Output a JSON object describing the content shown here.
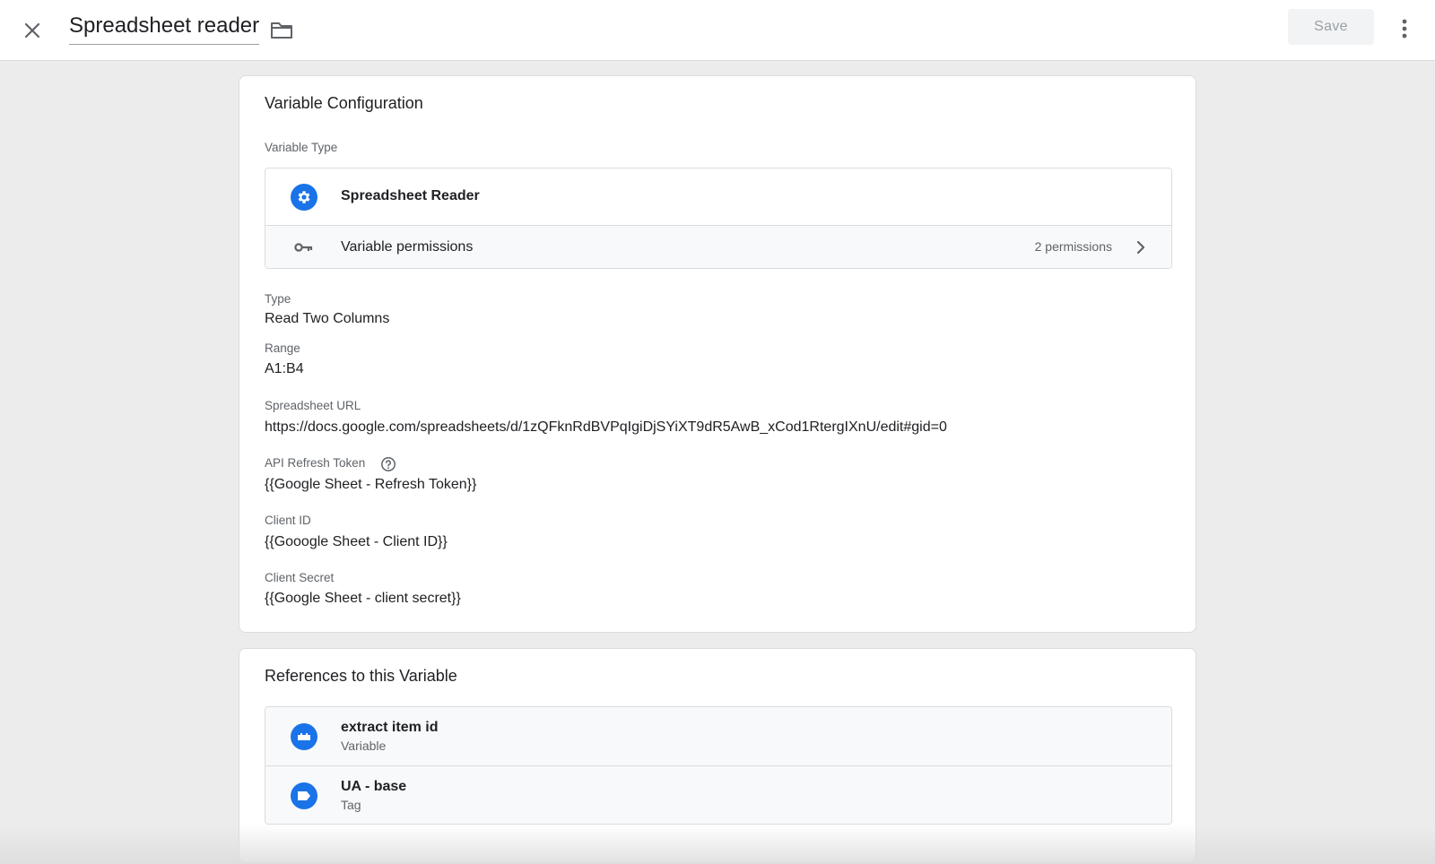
{
  "header": {
    "title": "Spreadsheet reader",
    "save_label": "Save"
  },
  "config": {
    "title": "Variable Configuration",
    "variable_type_label": "Variable Type",
    "variable_type_name": "Spreadsheet Reader",
    "permissions_label": "Variable permissions",
    "permissions_count": "2 permissions",
    "fields": {
      "type_label": "Type",
      "type_value": "Read Two Columns",
      "range_label": "Range",
      "range_value": "A1:B4",
      "url_label": "Spreadsheet URL",
      "url_value": "https://docs.google.com/spreadsheets/d/1zQFknRdBVPqIgiDjSYiXT9dR5AwB_xCod1RtergIXnU/edit#gid=0",
      "token_label": "API Refresh Token",
      "token_value": "{{Google Sheet - Refresh Token}}",
      "client_id_label": "Client ID",
      "client_id_value": "{{Gooogle Sheet - Client ID}}",
      "client_secret_label": "Client Secret",
      "client_secret_value": "{{Google Sheet - client secret}}"
    }
  },
  "references": {
    "title": "References to this Variable",
    "items": [
      {
        "name": "extract item id",
        "kind": "Variable",
        "icon": "variable-icon"
      },
      {
        "name": "UA - base",
        "kind": "Tag",
        "icon": "tag-icon"
      }
    ]
  },
  "colors": {
    "accent": "#1a73e8",
    "background": "#ececec",
    "card": "#ffffff",
    "border": "#dadce0",
    "muted_text": "#5f6368"
  },
  "icons": {
    "close": "close-icon",
    "folder": "folder-icon",
    "more": "more-vert-icon",
    "gear": "gear-icon",
    "key": "key-icon",
    "chevron": "chevron-right-icon",
    "help": "help-icon"
  }
}
